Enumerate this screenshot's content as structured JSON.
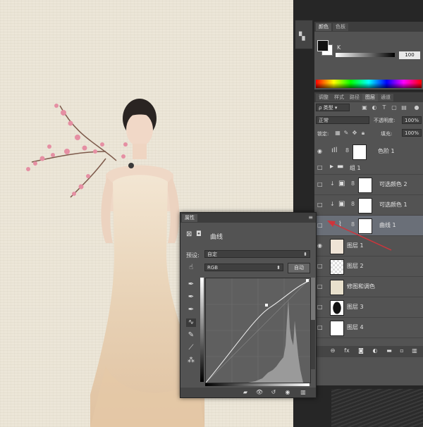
{
  "colors": {
    "canvas": "#ece6d8",
    "panel": "#535353",
    "selected_row": "#6a6f78",
    "arrow": "#d0343b"
  },
  "color_panel": {
    "tabs": [
      "颜色",
      "色板"
    ],
    "k_label": "K",
    "k_value": "100"
  },
  "layers_panel": {
    "tabs": [
      "调整",
      "样式",
      "路径",
      "图层",
      "通道"
    ],
    "filter_label": "类型",
    "blend_mode": "正常",
    "opacity_label": "不透明度:",
    "opacity_value": "100%",
    "lock_label": "锁定:",
    "fill_label": "填充:",
    "fill_value": "100%",
    "layers": [
      {
        "name": "色阶 1",
        "type": "levels"
      },
      {
        "name": "组 1",
        "type": "group"
      },
      {
        "name": "可选颜色 2",
        "type": "selective-color"
      },
      {
        "name": "可选颜色 1",
        "type": "selective-color"
      },
      {
        "name": "曲线 1",
        "type": "curves",
        "selected": true
      },
      {
        "name": "图层 1",
        "type": "pixel"
      },
      {
        "name": "图层 2",
        "type": "pixel"
      },
      {
        "name": "修图和调色",
        "type": "pixel"
      },
      {
        "name": "图层 3",
        "type": "pixel"
      },
      {
        "name": "图层 4",
        "type": "pixel"
      }
    ]
  },
  "properties_panel": {
    "title": "属性",
    "type_label": "曲线",
    "preset_label": "预设:",
    "preset_value": "自定",
    "channel_value": "RGB",
    "auto_button": "自动"
  }
}
